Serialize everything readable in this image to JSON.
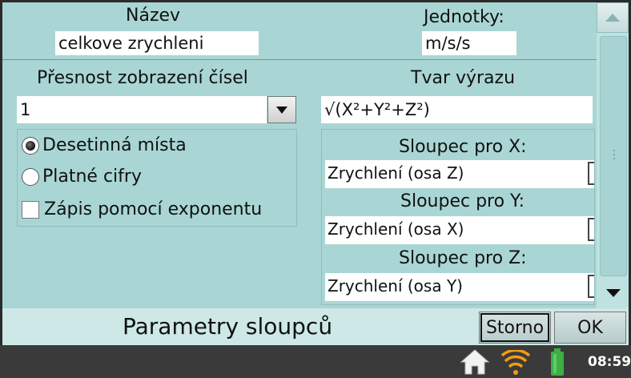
{
  "dialog": {
    "name_label": "Název",
    "name_value": "celkove zrychleni",
    "units_label": "Jednotky:",
    "units_value": "m/s/s",
    "precision_label": "Přesnost zobrazení čísel",
    "precision_value": "1",
    "expression_label": "Tvar výrazu",
    "expression_value": "√(X²+Y²+Z²)",
    "options": {
      "decimal_places": "Desetinná místa",
      "significant_figures": "Platné cifry",
      "exponent_notation": "Zápis pomocí exponentu"
    },
    "columns": {
      "x_label": "Sloupec pro X:",
      "x_value": "Zrychlení (osa Z)",
      "y_label": "Sloupec pro Y:",
      "y_value": "Zrychlení (osa X)",
      "z_label": "Sloupec pro Z:",
      "z_value": "Zrychlení (osa Y)"
    }
  },
  "footer": {
    "title": "Parametry sloupců",
    "cancel_label": "Storno",
    "ok_label": "OK"
  },
  "statusbar": {
    "time": "08:59",
    "icons": [
      "home-icon",
      "wifi-icon",
      "battery-icon"
    ]
  },
  "colors": {
    "dialog_bg": "#a9d6d4",
    "footer_bg": "#cde8e7",
    "statusbar_bg": "#3a3a3a",
    "wifi": "#f39c12",
    "battery": "#3cb043"
  }
}
